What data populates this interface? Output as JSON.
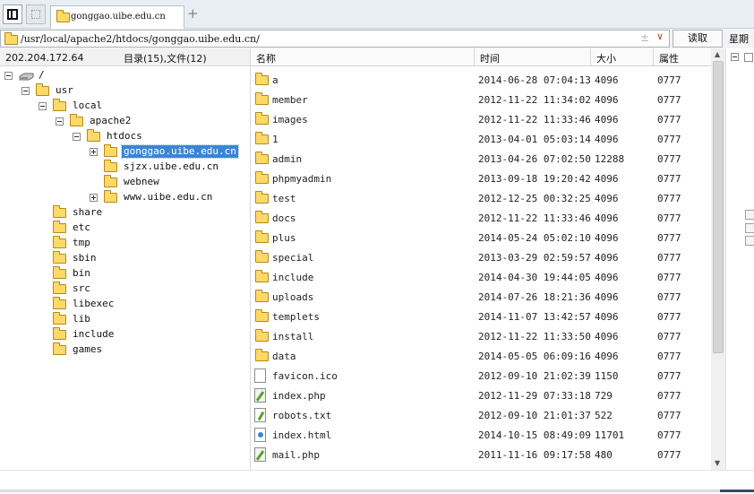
{
  "tab": {
    "label": "gonggao.uibe.edu.cn",
    "add_label": "+"
  },
  "address": {
    "path": "/usr/local/apache2/htdocs/gonggao.uibe.edu.cn/",
    "pin_glyph": "±",
    "dropdown_glyph": "∨"
  },
  "read_button": "读取",
  "week_label": "星期",
  "left": {
    "host": "202.204.172.64",
    "summary": "目录(15),文件(12)",
    "tree": [
      {
        "label": "/",
        "depth": 0,
        "expander": "minus",
        "icon": "drive-icon"
      },
      {
        "label": "usr",
        "depth": 1,
        "expander": "minus",
        "icon": "folder-icon"
      },
      {
        "label": "local",
        "depth": 2,
        "expander": "minus",
        "icon": "folder-icon"
      },
      {
        "label": "apache2",
        "depth": 3,
        "expander": "minus",
        "icon": "folder-icon"
      },
      {
        "label": "htdocs",
        "depth": 4,
        "expander": "minus",
        "icon": "folder-icon"
      },
      {
        "label": "gonggao.uibe.edu.cn",
        "depth": 5,
        "expander": "plus",
        "icon": "folder-icon",
        "selected": true
      },
      {
        "label": "sjzx.uibe.edu.cn",
        "depth": 5,
        "expander": "none",
        "icon": "folder-icon"
      },
      {
        "label": "webnew",
        "depth": 5,
        "expander": "none",
        "icon": "folder-icon"
      },
      {
        "label": "www.uibe.edu.cn",
        "depth": 5,
        "expander": "plus",
        "icon": "folder-icon"
      },
      {
        "label": "share",
        "depth": 2,
        "expander": "none",
        "icon": "folder-icon"
      },
      {
        "label": "etc",
        "depth": 2,
        "expander": "none",
        "icon": "folder-icon"
      },
      {
        "label": "tmp",
        "depth": 2,
        "expander": "none",
        "icon": "folder-icon"
      },
      {
        "label": "sbin",
        "depth": 2,
        "expander": "none",
        "icon": "folder-icon"
      },
      {
        "label": "bin",
        "depth": 2,
        "expander": "none",
        "icon": "folder-icon"
      },
      {
        "label": "src",
        "depth": 2,
        "expander": "none",
        "icon": "folder-icon"
      },
      {
        "label": "libexec",
        "depth": 2,
        "expander": "none",
        "icon": "folder-icon"
      },
      {
        "label": "lib",
        "depth": 2,
        "expander": "none",
        "icon": "folder-icon"
      },
      {
        "label": "include",
        "depth": 2,
        "expander": "none",
        "icon": "folder-icon"
      },
      {
        "label": "games",
        "depth": 2,
        "expander": "none",
        "icon": "folder-icon"
      }
    ]
  },
  "files": {
    "columns": {
      "name": "名称",
      "time": "时间",
      "size": "大小",
      "perm": "属性"
    },
    "rows": [
      {
        "name": "a",
        "time": "2014-06-28 07:04:13",
        "size": "4096",
        "perm": "0777",
        "type": "folder"
      },
      {
        "name": "member",
        "time": "2012-11-22 11:34:02",
        "size": "4096",
        "perm": "0777",
        "type": "folder"
      },
      {
        "name": "images",
        "time": "2012-11-22 11:33:46",
        "size": "4096",
        "perm": "0777",
        "type": "folder"
      },
      {
        "name": "1",
        "time": "2013-04-01 05:03:14",
        "size": "4096",
        "perm": "0777",
        "type": "folder"
      },
      {
        "name": "admin",
        "time": "2013-04-26 07:02:50",
        "size": "12288",
        "perm": "0777",
        "type": "folder"
      },
      {
        "name": "phpmyadmin",
        "time": "2013-09-18 19:20:42",
        "size": "4096",
        "perm": "0777",
        "type": "folder"
      },
      {
        "name": "test",
        "time": "2012-12-25 00:32:25",
        "size": "4096",
        "perm": "0777",
        "type": "folder"
      },
      {
        "name": "docs",
        "time": "2012-11-22 11:33:46",
        "size": "4096",
        "perm": "0777",
        "type": "folder"
      },
      {
        "name": "plus",
        "time": "2014-05-24 05:02:10",
        "size": "4096",
        "perm": "0777",
        "type": "folder"
      },
      {
        "name": "special",
        "time": "2013-03-29 02:59:57",
        "size": "4096",
        "perm": "0777",
        "type": "folder"
      },
      {
        "name": "include",
        "time": "2014-04-30 19:44:05",
        "size": "4096",
        "perm": "0777",
        "type": "folder"
      },
      {
        "name": "uploads",
        "time": "2014-07-26 18:21:36",
        "size": "4096",
        "perm": "0777",
        "type": "folder"
      },
      {
        "name": "templets",
        "time": "2014-11-07 13:42:57",
        "size": "4096",
        "perm": "0777",
        "type": "folder"
      },
      {
        "name": "install",
        "time": "2012-11-22 11:33:50",
        "size": "4096",
        "perm": "0777",
        "type": "folder"
      },
      {
        "name": "data",
        "time": "2014-05-05 06:09:16",
        "size": "4096",
        "perm": "0777",
        "type": "folder"
      },
      {
        "name": "favicon.ico",
        "time": "2012-09-10 21:02:39",
        "size": "1150",
        "perm": "0777",
        "type": "file"
      },
      {
        "name": "index.php",
        "time": "2012-11-29 07:33:18",
        "size": "729",
        "perm": "0777",
        "type": "php"
      },
      {
        "name": "robots.txt",
        "time": "2012-09-10 21:01:37",
        "size": "522",
        "perm": "0777",
        "type": "txt"
      },
      {
        "name": "index.html",
        "time": "2014-10-15 08:49:09",
        "size": "11701",
        "perm": "0777",
        "type": "html"
      },
      {
        "name": "mail.php",
        "time": "2011-11-16 09:17:58",
        "size": "480",
        "perm": "0777",
        "type": "php"
      }
    ]
  },
  "scroll": {
    "up_glyph": "▲",
    "down_glyph": "▼"
  },
  "colors": {
    "selection": "#3b86d4",
    "folder": "#ffd966",
    "folder_border": "#b6891c"
  }
}
